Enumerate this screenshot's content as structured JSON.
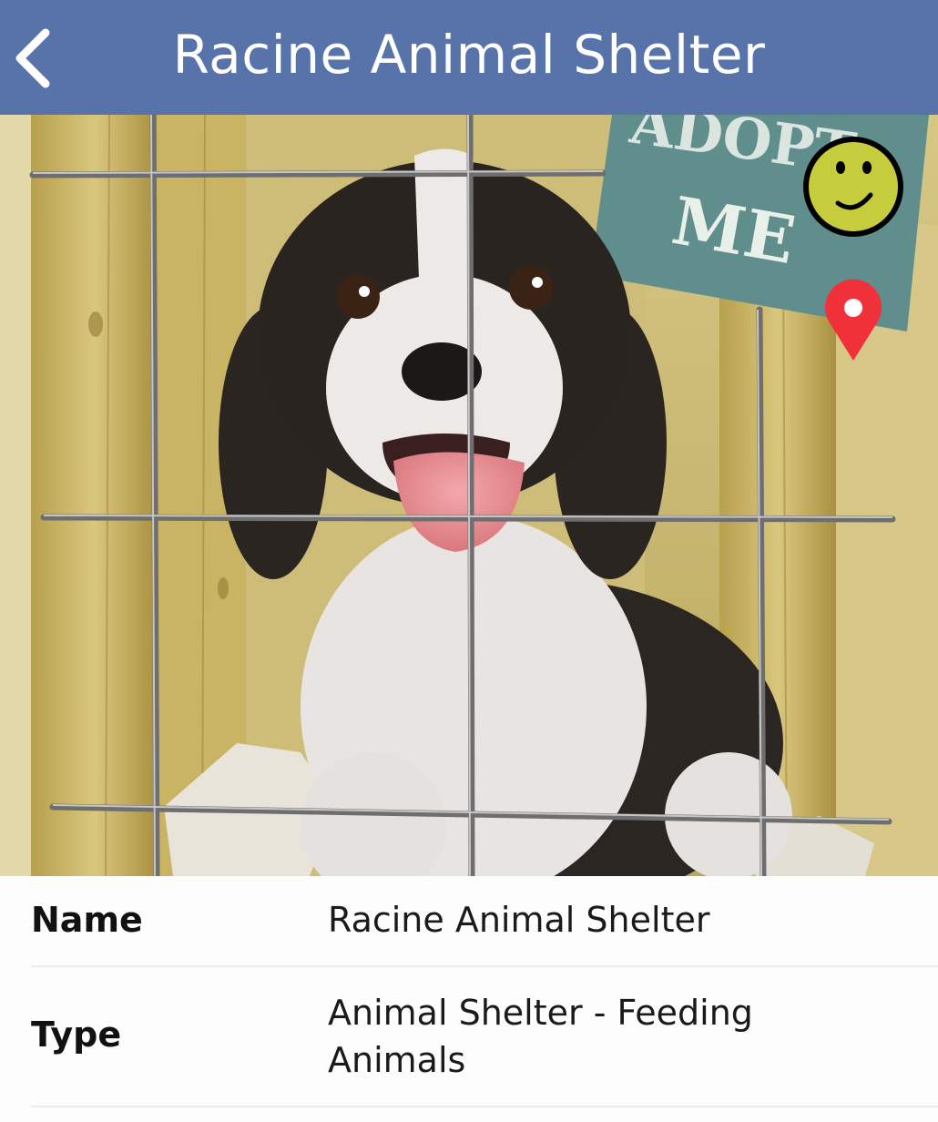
{
  "header": {
    "title": "Racine Animal Shelter",
    "back_icon": "chevron-left-icon"
  },
  "photo": {
    "subject": "puppy-behind-cage",
    "sign_text": "ADOPT ME",
    "smiley_icon": "smiley-face-icon",
    "pin_icon": "location-pin-icon",
    "colors": {
      "smiley": "#c5cd3c",
      "pin": "#f0313a",
      "sign": "#5f8e8c"
    }
  },
  "details": {
    "rows": [
      {
        "label": "Name",
        "value": "Racine Animal Shelter"
      },
      {
        "label": "Type",
        "value_lines": [
          "Animal Shelter - Feeding",
          "Animals"
        ]
      }
    ]
  },
  "colors": {
    "nav_bar": "#5773a9",
    "nav_text": "#ffffff",
    "divider": "#ececec"
  }
}
